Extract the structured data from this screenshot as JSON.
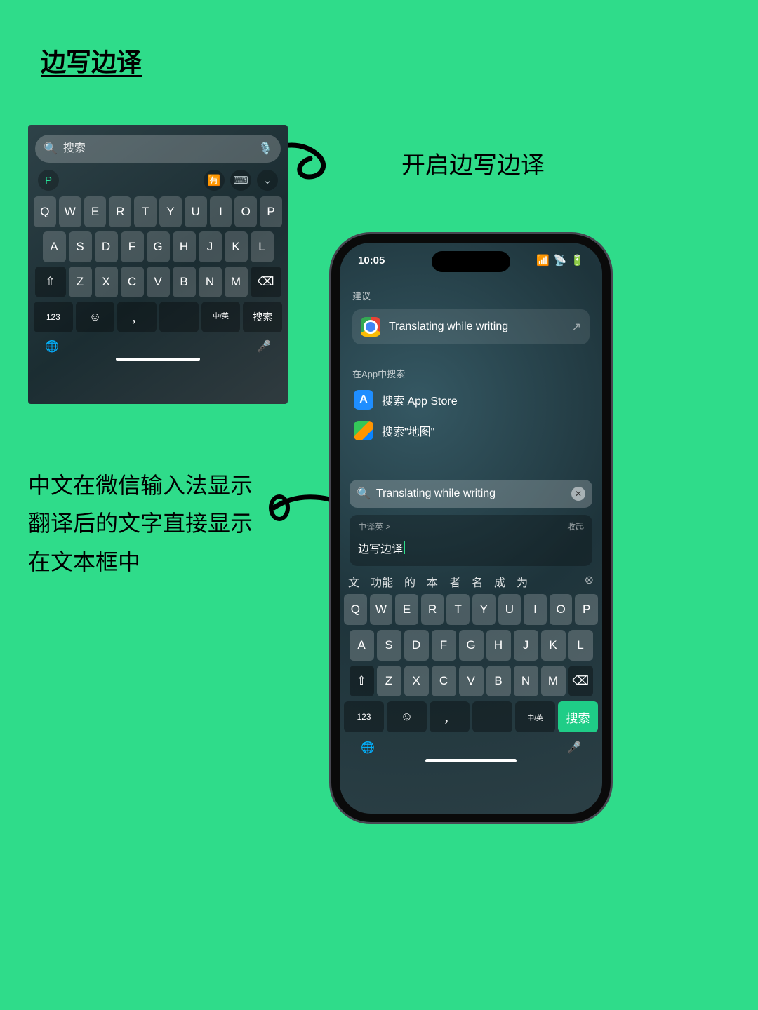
{
  "title": "边写边译",
  "caption_right": "开启边写边译",
  "caption_left": "中文在微信输入法显示\n翻译后的文字直接显示\n在文本框中",
  "panel1": {
    "search_placeholder": "搜索",
    "keys_row1": [
      "Q",
      "W",
      "E",
      "R",
      "T",
      "Y",
      "U",
      "I",
      "O",
      "P"
    ],
    "keys_row2": [
      "A",
      "S",
      "D",
      "F",
      "G",
      "H",
      "J",
      "K",
      "L"
    ],
    "keys_row3_shift": "⇧",
    "keys_row3": [
      "Z",
      "X",
      "C",
      "V",
      "B",
      "N",
      "M"
    ],
    "keys_row3_del": "⌫",
    "key_123": "123",
    "key_emoji": "☺",
    "key_comma": "，",
    "key_lang": "中/英",
    "key_search": "搜索",
    "globe": "🌐",
    "mic": "🎤"
  },
  "phone": {
    "time": "10:05",
    "suggest_label": "建议",
    "suggestion_text": "Translating while writing",
    "search_apps_label": "在App中搜索",
    "app_store": "搜索 App Store",
    "maps": "搜索\"地图\"",
    "search_value": "Translating while writing",
    "translate_mode": "中译英 >",
    "collapse": "收起",
    "translate_input": "边写边译",
    "candidates": [
      "文",
      "功能",
      "的",
      "本",
      "者",
      "名",
      "成",
      "为"
    ],
    "keys_row1": [
      "Q",
      "W",
      "E",
      "R",
      "T",
      "Y",
      "U",
      "I",
      "O",
      "P"
    ],
    "keys_row2": [
      "A",
      "S",
      "D",
      "F",
      "G",
      "H",
      "J",
      "K",
      "L"
    ],
    "keys_row3_shift": "⇧",
    "keys_row3": [
      "Z",
      "X",
      "C",
      "V",
      "B",
      "N",
      "M"
    ],
    "keys_row3_del": "⌫",
    "key_123": "123",
    "key_emoji": "☺",
    "key_comma": "，",
    "key_lang": "中/英",
    "key_search": "搜索",
    "globe": "🌐",
    "mic": "🎤"
  }
}
